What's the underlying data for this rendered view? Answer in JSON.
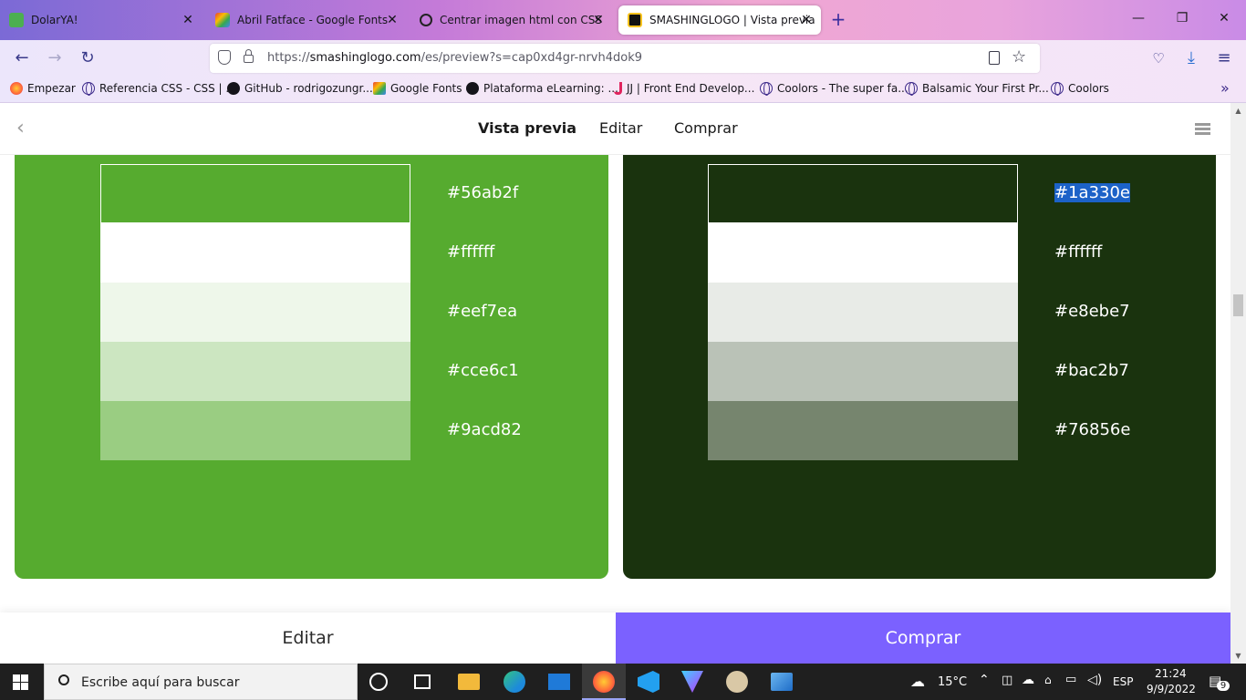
{
  "browser": {
    "tabs": [
      {
        "label": "DolarYA!",
        "favicon_color": "#4caf50"
      },
      {
        "label": "Abril Fatface - Google Fonts",
        "favicon_color": "#ea4335"
      },
      {
        "label": "Centrar imagen html con CSS",
        "favicon_color": "#222222"
      },
      {
        "label": "SMASHINGLOGO | Vista previa",
        "favicon_color": "#f7c21d"
      }
    ],
    "url": {
      "prefix": "https://",
      "host": "smashinglogo.com",
      "path": "/es/preview?s=cap0xd4gr-nrvh4dok9"
    },
    "bookmarks": [
      {
        "label": "Empezar"
      },
      {
        "label": "Referencia CSS - CSS | ..."
      },
      {
        "label": "GitHub - rodrigozungr..."
      },
      {
        "label": "Google Fonts"
      },
      {
        "label": "Plataforma eLearning: ..."
      },
      {
        "label": "JJ | Front End Develop..."
      },
      {
        "label": "Coolors - The super fa..."
      },
      {
        "label": "Balsamic  Your First Pr..."
      },
      {
        "label": "Coolors"
      }
    ]
  },
  "site": {
    "nav": {
      "preview": "Vista previa",
      "edit": "Editar",
      "buy": "Comprar"
    },
    "palettes": [
      {
        "background": "#56ab2f",
        "swatches": [
          {
            "hex": "#56ab2f",
            "color": "#56ab2f"
          },
          {
            "hex": "#ffffff",
            "color": "#ffffff"
          },
          {
            "hex": "#eef7ea",
            "color": "#eef7ea"
          },
          {
            "hex": "#cce6c1",
            "color": "#cce6c1"
          },
          {
            "hex": "#9acd82",
            "color": "#9acd82"
          }
        ]
      },
      {
        "background": "#1a330e",
        "swatches": [
          {
            "hex": "#1a330e",
            "color": "#1a330e"
          },
          {
            "hex": "#ffffff",
            "color": "#ffffff"
          },
          {
            "hex": "#e8ebe7",
            "color": "#e8ebe7"
          },
          {
            "hex": "#bac2b7",
            "color": "#bac2b7"
          },
          {
            "hex": "#76856e",
            "color": "#76856e"
          }
        ]
      }
    ],
    "bottom": {
      "edit": "Editar",
      "buy": "Comprar"
    }
  },
  "taskbar": {
    "search_placeholder": "Escribe aquí para buscar",
    "weather": "15°C",
    "language": "ESP",
    "time": "21:24",
    "date": "9/9/2022",
    "notifications": "9"
  }
}
